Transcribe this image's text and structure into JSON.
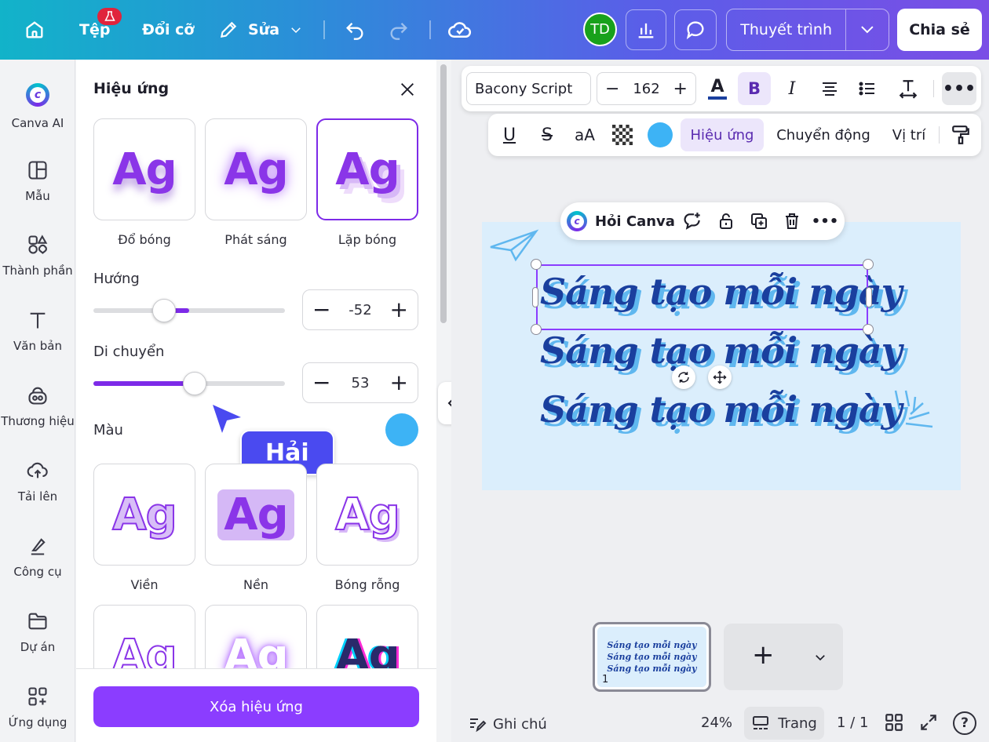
{
  "topbar": {
    "file": "Tệp",
    "resize": "Đổi cỡ",
    "edit": "Sửa",
    "avatar": "TD",
    "present": "Thuyết trình",
    "share": "Chia sẻ"
  },
  "leftnav": {
    "items": [
      {
        "label": "Canva AI",
        "icon": "canva-ai-icon"
      },
      {
        "label": "Mẫu",
        "icon": "template-icon"
      },
      {
        "label": "Thành phần",
        "icon": "elements-icon"
      },
      {
        "label": "Văn bản",
        "icon": "text-icon"
      },
      {
        "label": "Thương hiệu",
        "icon": "brand-icon"
      },
      {
        "label": "Tải lên",
        "icon": "upload-icon"
      },
      {
        "label": "Công cụ",
        "icon": "tools-icon"
      },
      {
        "label": "Dự án",
        "icon": "folder-icon"
      },
      {
        "label": "Ứng dụng",
        "icon": "apps-icon"
      }
    ]
  },
  "panel": {
    "title": "Hiệu ứng",
    "styles_top": [
      "Đổ bóng",
      "Phát sáng",
      "Lặp bóng"
    ],
    "card_text": "Ag",
    "direction_label": "Hướng",
    "direction_value": "-52",
    "direction_fraction": 0.37,
    "move_label": "Di chuyển",
    "move_value": "53",
    "move_fraction": 0.53,
    "color_label": "Màu",
    "color_value": "#3db3f5",
    "styles_bottom": [
      "Viền",
      "Nền",
      "Bóng rỗng"
    ],
    "remove_button": "Xóa hiệu ứng",
    "cursor_name": "Hải"
  },
  "toolbar": {
    "font": "Bacony Script",
    "size": "162",
    "effects": "Hiệu ứng",
    "animate": "Chuyển động",
    "position": "Vị trí"
  },
  "canvas": {
    "ask": "Hỏi Canva",
    "lines": [
      "Sáng tạo mỗi ngày",
      "Sáng tạo mỗi ngày",
      "Sáng tạo mỗi ngày"
    ],
    "page_number": "1"
  },
  "footer": {
    "notes": "Ghi chú",
    "zoom": "24%",
    "pages": "Trang",
    "page_count": "1 / 1"
  },
  "colors": {
    "accent": "#7d2ae8",
    "text_blue": "#1a3f9e",
    "shadow_blue": "#5fb7ef",
    "canvas_bg": "#dbeefc"
  }
}
